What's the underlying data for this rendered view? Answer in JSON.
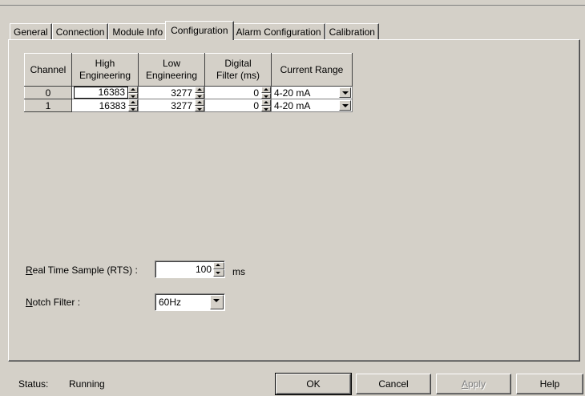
{
  "tabs": [
    "General",
    "Connection",
    "Module Info",
    "Configuration",
    "Alarm Configuration",
    "Calibration"
  ],
  "active_tab": "Configuration",
  "grid": {
    "headers": {
      "channel": "Channel",
      "high_line1": "High",
      "high_line2": "Engineering",
      "low_line1": "Low",
      "low_line2": "Engineering",
      "filter_line1": "Digital",
      "filter_line2": "Filter (ms)",
      "range": "Current Range"
    },
    "rows": [
      {
        "channel": "0",
        "high": "16383",
        "low": "3277",
        "filter": "0",
        "range": "4-20 mA"
      },
      {
        "channel": "1",
        "high": "16383",
        "low": "3277",
        "filter": "0",
        "range": "4-20 mA"
      }
    ]
  },
  "rts": {
    "label_ul": "R",
    "label_rest": "eal Time Sample (RTS) :",
    "value": "100",
    "unit": "ms"
  },
  "notch": {
    "label_ul": "N",
    "label_rest": "otch Filter :",
    "value": "60Hz"
  },
  "status": {
    "label": "Status:",
    "value": "Running"
  },
  "buttons": {
    "ok": "OK",
    "cancel": "Cancel",
    "apply_ul": "A",
    "apply_rest": "pply",
    "help": "Help"
  }
}
